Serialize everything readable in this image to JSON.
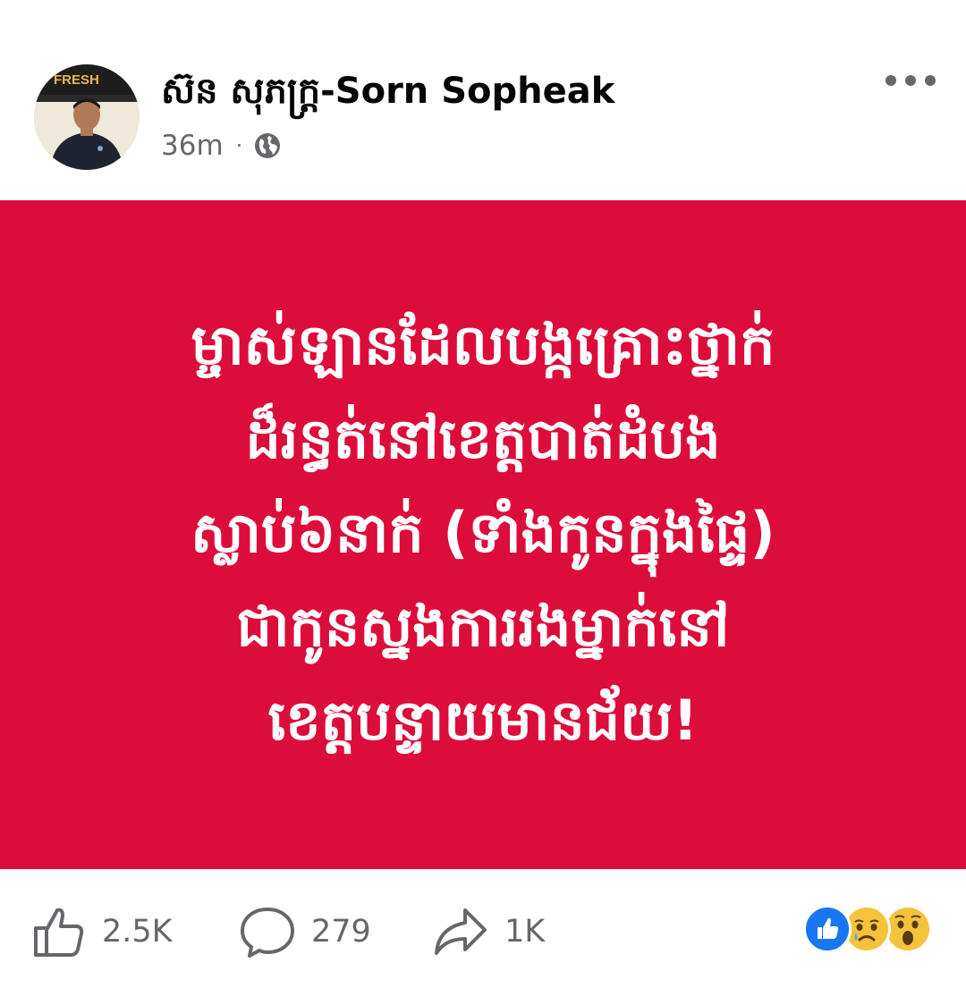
{
  "post": {
    "author": "ស៊ន សុភក្រ្ត-Sorn Sopheak",
    "timestamp": "36m",
    "separator": "·",
    "privacy_icon": "globe-icon",
    "avatar_sign": "FRESH"
  },
  "banner": {
    "background": "#dc0d3a",
    "lines": [
      "ម្ចាស់ឡានដែលបង្កគ្រោះថ្នាក់",
      "ដ៏រន្ធត់នៅខេត្តបាត់ដំបង",
      "ស្លាប់៦នាក់ (ទាំងកូនក្នុងផ្ទៃ)",
      "ជាកូនស្នងការរងម្នាក់នៅ",
      "ខេត្តបន្ទាយមានជ័យ!"
    ]
  },
  "footer": {
    "like_count": "2.5K",
    "comment_count": "279",
    "share_count": "1K",
    "reactions": [
      "like-icon",
      "sad-icon",
      "wow-icon"
    ],
    "accent": "#1877f2",
    "muted": "#65676b"
  }
}
